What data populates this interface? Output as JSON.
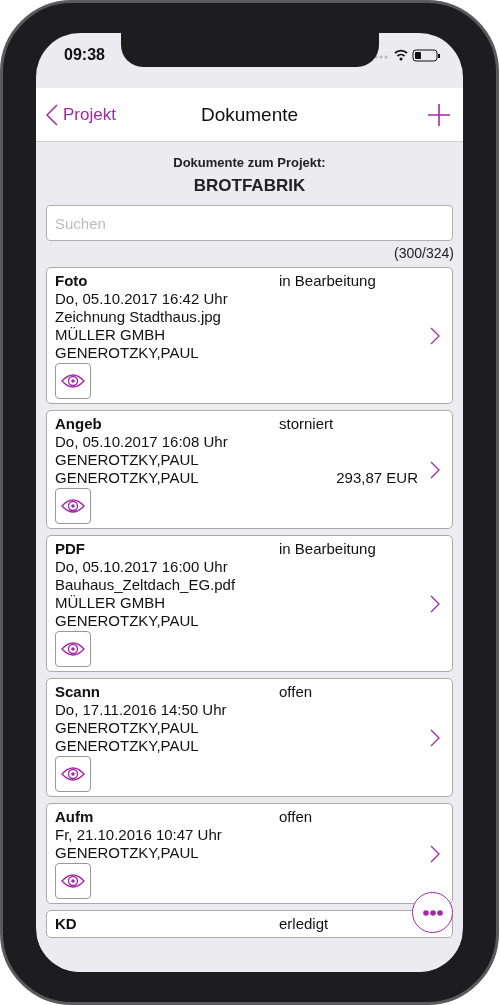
{
  "status_bar": {
    "time": "09:38"
  },
  "nav": {
    "back_label": "Projekt",
    "title": "Dokumente"
  },
  "header": {
    "subtitle": "Dokumente zum Projekt:",
    "project": "BROTFABRIK"
  },
  "search": {
    "placeholder": "Suchen"
  },
  "count": "(300/324)",
  "documents": [
    {
      "type": "Foto",
      "status": "in Bearbeitung",
      "lines": [
        "Do, 05.10.2017 16:42 Uhr",
        "Zeichnung Stadthaus.jpg",
        "MÜLLER GMBH",
        "GENEROTZKY,PAUL"
      ]
    },
    {
      "type": "Angeb",
      "status": "storniert",
      "lines": [
        "Do, 05.10.2017 16:08 Uhr",
        "GENEROTZKY,PAUL",
        "GENEROTZKY,PAUL"
      ],
      "amount": "293,87 EUR"
    },
    {
      "type": "PDF",
      "status": "in Bearbeitung",
      "lines": [
        "Do, 05.10.2017 16:00 Uhr",
        "Bauhaus_Zeltdach_EG.pdf",
        "MÜLLER GMBH",
        "GENEROTZKY,PAUL"
      ]
    },
    {
      "type": "Scann",
      "status": "offen",
      "lines": [
        "Do, 17.11.2016 14:50 Uhr",
        "GENEROTZKY,PAUL",
        "GENEROTZKY,PAUL"
      ]
    },
    {
      "type": "Aufm",
      "status": "offen",
      "lines": [
        "Fr, 21.10.2016 10:47 Uhr",
        "GENEROTZKY,PAUL"
      ]
    },
    {
      "type": "KD",
      "status": "erledigt"
    }
  ]
}
